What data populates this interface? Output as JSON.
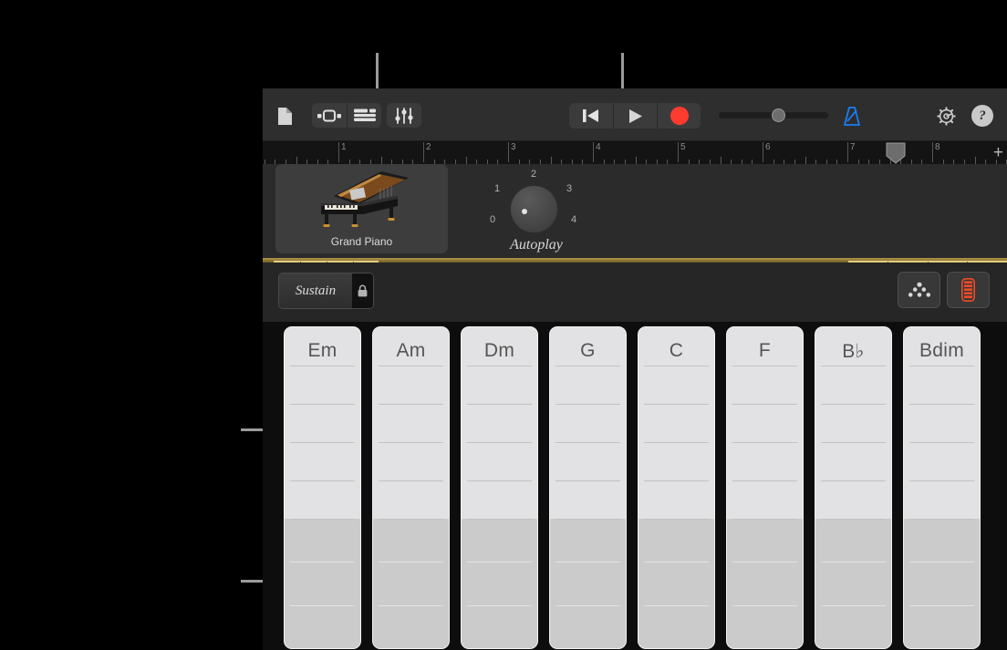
{
  "toolbar": {
    "doc_icon": "document-icon",
    "view_instrument_icon": "instrument-view-icon",
    "view_tracks_icon": "tracks-view-icon",
    "fx_icon": "mixer-fader-icon",
    "rewind_label": "rewind-icon",
    "play_label": "play-icon",
    "record_label": "record-icon",
    "metronome_icon": "metronome-icon",
    "settings_icon": "gear-icon",
    "help_icon": "help-icon",
    "metronome_color": "#1a7df5",
    "record_color": "#ff3b30",
    "volume_value": 50
  },
  "ruler": {
    "bars": [
      "1",
      "2",
      "3",
      "4",
      "5",
      "6",
      "7",
      "8"
    ],
    "playhead_bar": "7.5",
    "add_label": "+"
  },
  "instrument": {
    "name": "Grand Piano",
    "art": "grand-piano-image"
  },
  "autoplay": {
    "label": "Autoplay",
    "marks": [
      "0",
      "1",
      "2",
      "3",
      "4"
    ],
    "value": "0"
  },
  "controls": {
    "sustain_label": "Sustain",
    "lock_icon": "lock-icon",
    "arpeggiator_icon": "arpeggiator-icon",
    "chord_strip_icon": "chord-strip-icon",
    "chord_strip_color": "#ee4b28"
  },
  "chords": {
    "columns": [
      {
        "name": "Em"
      },
      {
        "name": "Am"
      },
      {
        "name": "Dm"
      },
      {
        "name": "G"
      },
      {
        "name": "C"
      },
      {
        "name": "F"
      },
      {
        "name": "B♭"
      },
      {
        "name": "Bdim"
      }
    ],
    "upper_segments": 5,
    "lower_segments": 3
  },
  "callouts": {
    "instrument_pointer": "callout-to-instrument",
    "autoplay_pointer": "callout-to-autoplay",
    "upper_bracket": "bracket-upper-chord-zone",
    "lower_bracket": "bracket-lower-chord-zone"
  }
}
